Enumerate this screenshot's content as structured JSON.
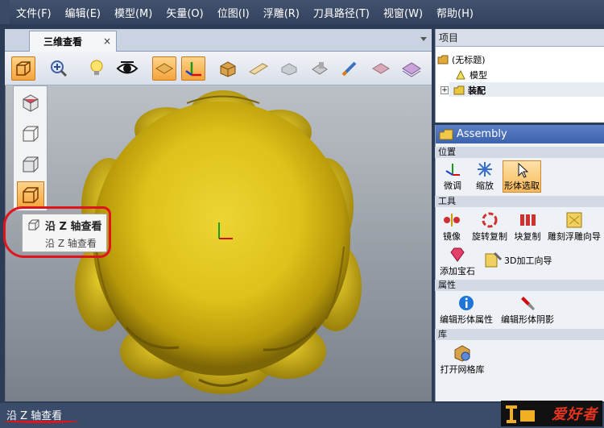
{
  "menu": [
    "文件(F)",
    "编辑(E)",
    "模型(M)",
    "矢量(O)",
    "位图(I)",
    "浮雕(R)",
    "刀具路径(T)",
    "视窗(W)",
    "帮助(H)"
  ],
  "doc_tab": {
    "title": "三维查看",
    "close": "×"
  },
  "toolbar_icons": [
    "view-cube-icon",
    "zoom-icon",
    "light-bulb-icon",
    "eye-icon",
    "plane-icon",
    "axes-icon",
    "box-icon",
    "bar-icon",
    "shape-icon",
    "render-icon",
    "brush-icon",
    "mesh-icon",
    "layer-icon"
  ],
  "tooltip": {
    "title": "沿 Z 轴查看",
    "description": "沿 Z 轴查看"
  },
  "project": {
    "header": "项目",
    "tree": [
      {
        "label": "(无标题)",
        "icon": "folder-icon"
      },
      {
        "label": "模型",
        "icon": "model-icon"
      },
      {
        "label": "装配",
        "icon": "assembly-icon"
      }
    ]
  },
  "assembly": {
    "header": "Assembly",
    "sections": {
      "position": "位置",
      "tools": "工具",
      "attributes": "属性",
      "library": "库"
    },
    "position_tools": [
      "微调",
      "缩放",
      "形体选取"
    ],
    "tools": [
      "镜像",
      "旋转复制",
      "块复制",
      "雕刻浮雕向导",
      "添加宝石",
      "3D加工向导"
    ],
    "attribute_tools": [
      "编辑形体属性",
      "编辑形体阴影"
    ],
    "library_tools": [
      "打开网格库"
    ]
  },
  "status": {
    "text": "沿 Z 轴查看"
  },
  "logo": {
    "text": "爱好者"
  },
  "colors": {
    "accent": "#f5a43b",
    "model_gold": "#e0c21c",
    "title_blue": "#3e63ad",
    "highlight_red": "#e0141c"
  }
}
